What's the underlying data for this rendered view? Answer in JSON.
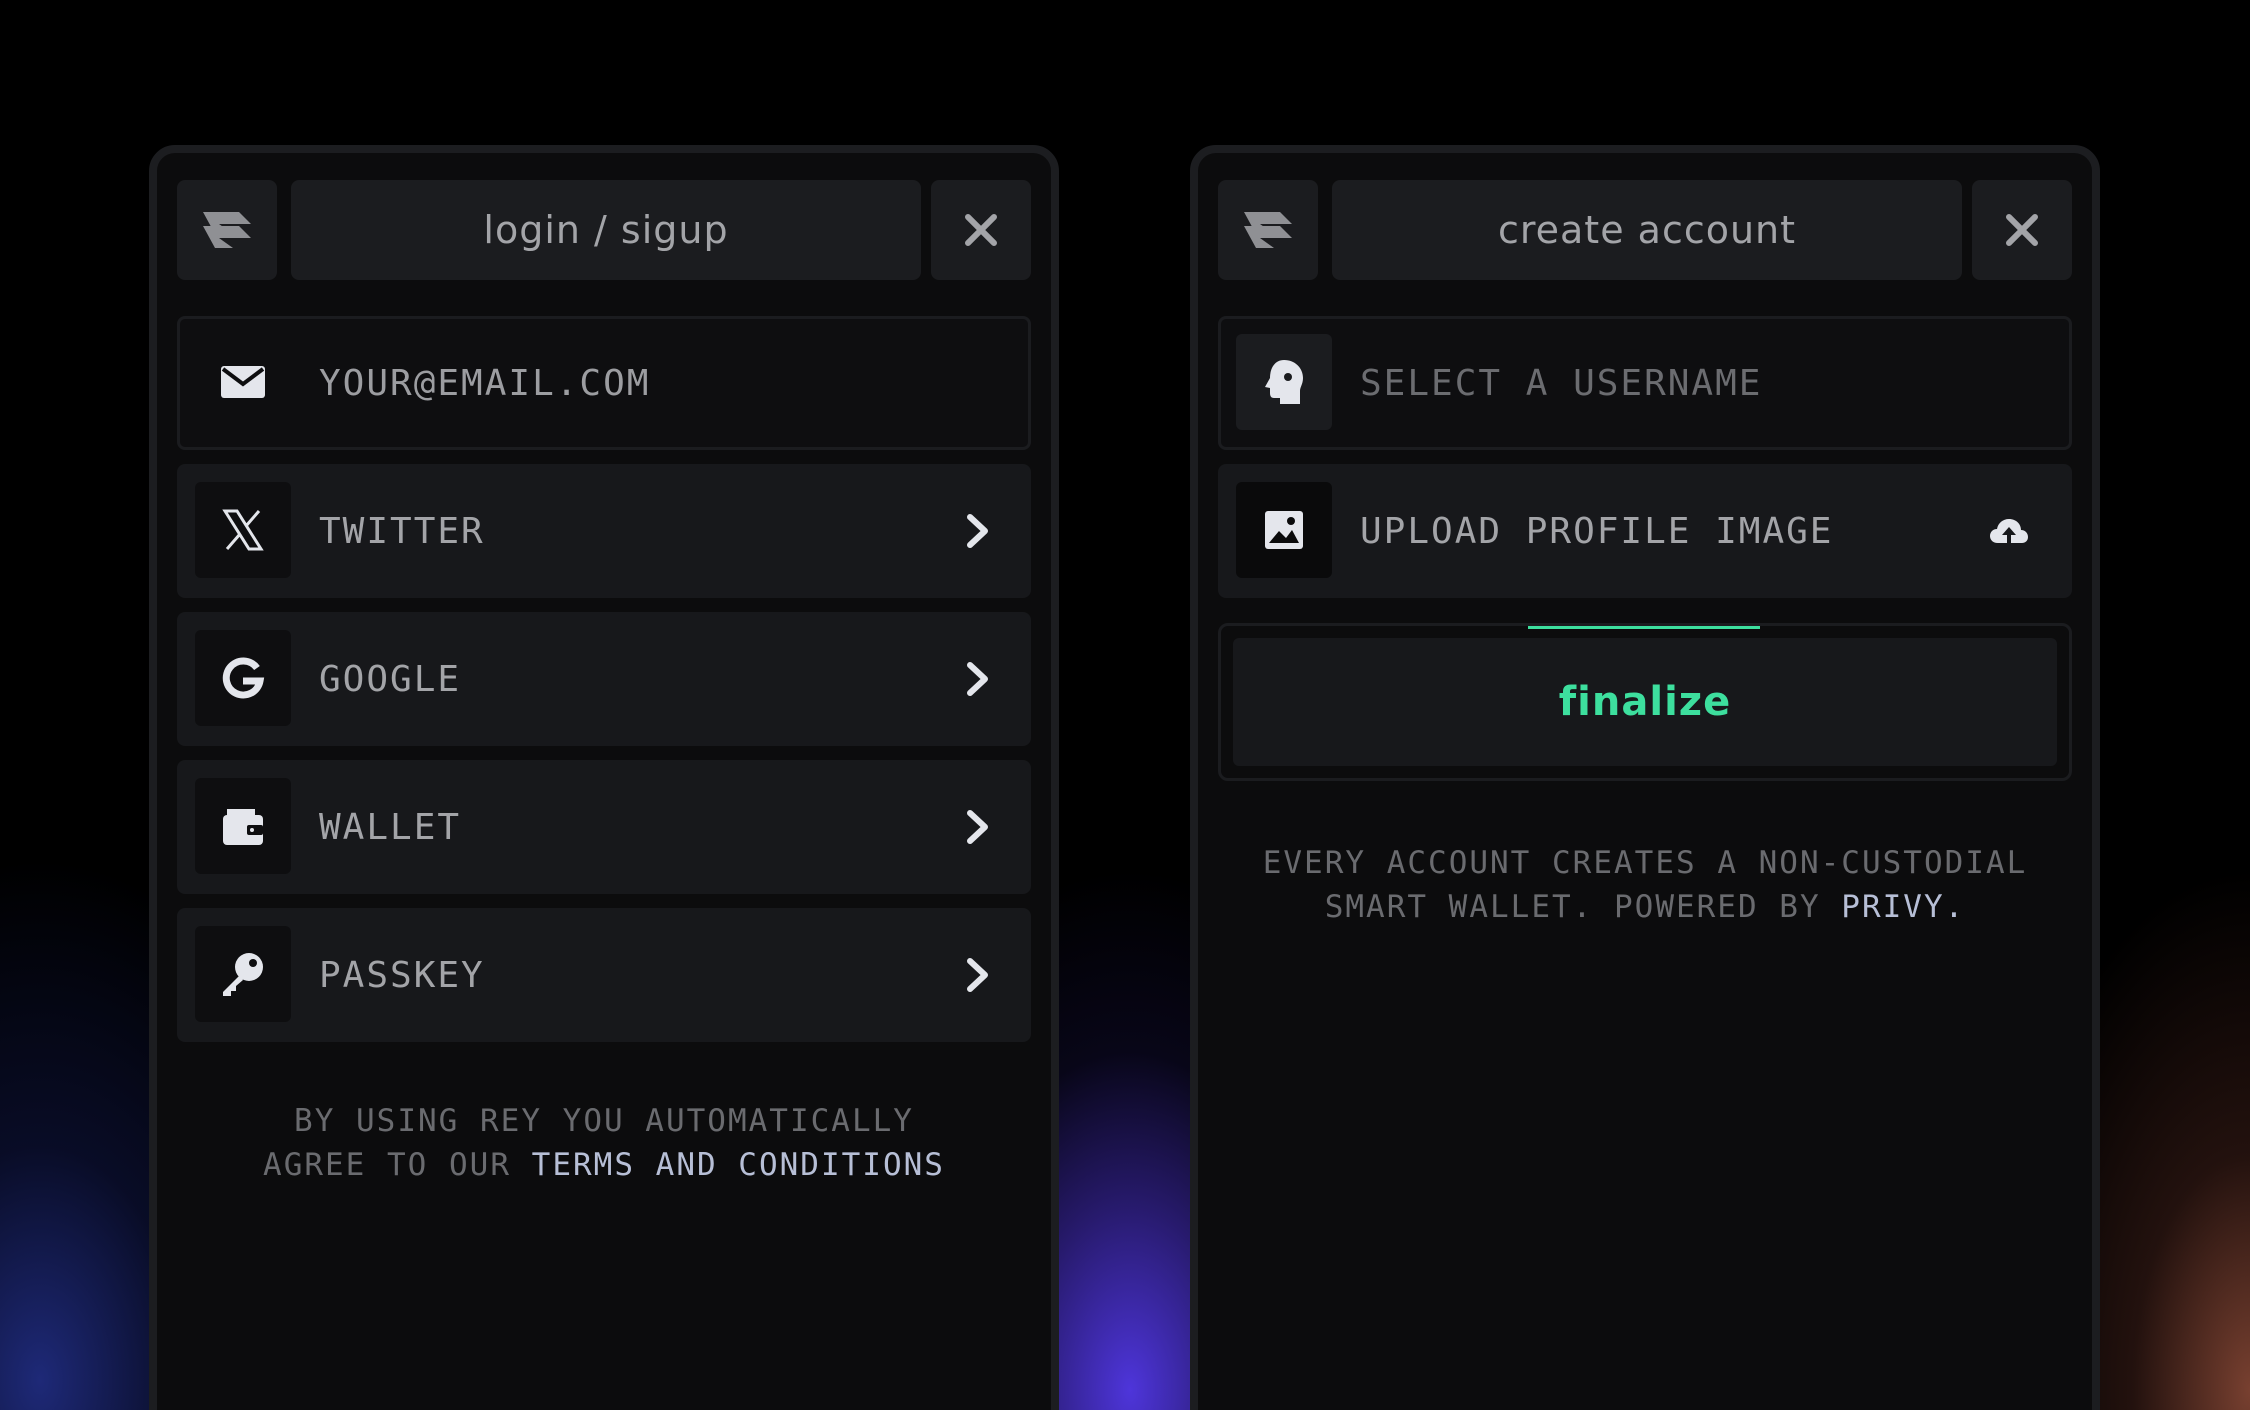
{
  "colors": {
    "accent": "#3ddf9e",
    "panel_bg": "#0c0c0d",
    "row_bg": "#17181b",
    "highlight_text": "#b7bfd6"
  },
  "login_panel": {
    "title": "login / sigup",
    "logo_icon": "rey-logo-icon",
    "close_icon": "close-icon",
    "email": {
      "icon": "envelope-icon",
      "placeholder": "YOUR@EMAIL.COM"
    },
    "options": [
      {
        "label": "TWITTER",
        "icon": "x-twitter-icon"
      },
      {
        "label": "GOOGLE",
        "icon": "google-icon"
      },
      {
        "label": "WALLET",
        "icon": "wallet-icon"
      },
      {
        "label": "PASSKEY",
        "icon": "key-icon"
      }
    ],
    "footer": {
      "line1": "BY USING REY YOU AUTOMATICALLY",
      "line2_prefix": "AGREE TO OUR ",
      "link": "TERMS AND CONDITIONS"
    }
  },
  "create_panel": {
    "title": "create account",
    "logo_icon": "rey-logo-icon",
    "close_icon": "close-icon",
    "username": {
      "icon": "head-profile-icon",
      "placeholder": "SELECT A USERNAME"
    },
    "upload": {
      "icon": "image-icon",
      "label": "UPLOAD PROFILE IMAGE",
      "action_icon": "cloud-upload-icon"
    },
    "finalize_label": "finalize",
    "footer": {
      "line1": "EVERY ACCOUNT CREATES A NON-CUSTODIAL",
      "line2_prefix": "SMART WALLET. POWERED BY ",
      "link": "PRIVY."
    }
  }
}
